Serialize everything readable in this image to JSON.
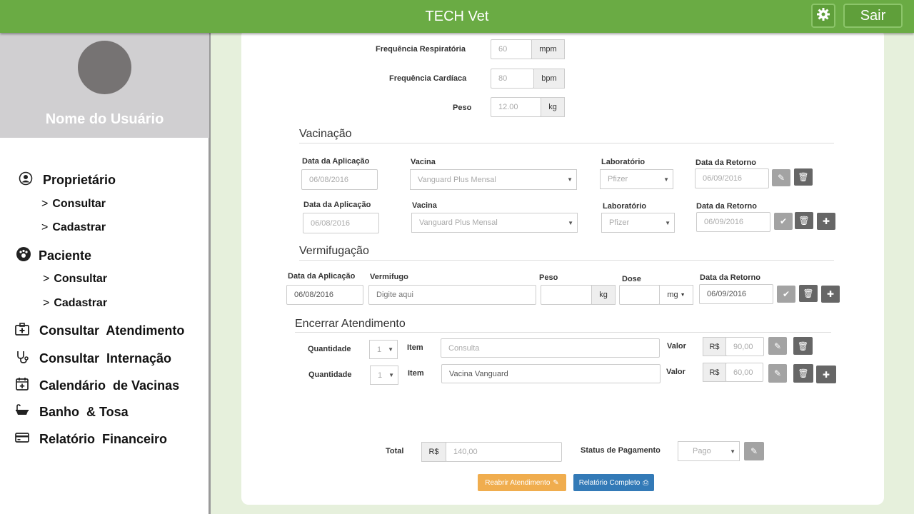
{
  "header": {
    "title": "TECH Vet",
    "logout": "Sair",
    "settings_icon": "gear-icon"
  },
  "sidebar": {
    "user_name": "Nome do Usuário",
    "items": [
      {
        "label": "Proprietário",
        "icon": "user-circle-icon",
        "subitems": [
          "Consultar",
          "Cadastrar"
        ]
      },
      {
        "label": "Paciente",
        "icon": "paw-icon",
        "subitems": [
          "Consultar",
          "Cadastrar"
        ]
      },
      {
        "label": "Consultar  Atendimento",
        "icon": "medical-kit-icon"
      },
      {
        "label": "Consultar  Internação",
        "icon": "stethoscope-icon"
      },
      {
        "label": "Calendário  de Vacinas",
        "icon": "calendar-plus-icon"
      },
      {
        "label": "Banho  & Tosa",
        "icon": "bathtub-icon"
      },
      {
        "label": "Relatório  Financeiro",
        "icon": "credit-card-icon"
      }
    ]
  },
  "vitals": [
    {
      "label": "Frequência Respiratória",
      "value": "60",
      "unit": "mpm"
    },
    {
      "label": "Frequência Cardíaca",
      "value": "80",
      "unit": "bpm"
    },
    {
      "label": "Peso",
      "value": "12.00",
      "unit": "kg"
    }
  ],
  "vacinacao": {
    "title": "Vacinação",
    "labels": {
      "date": "Data da Aplicação",
      "vaccine": "Vacina",
      "lab": "Laboratório",
      "return": "Data da Retorno"
    },
    "rows": [
      {
        "date": "06/08/2016",
        "vaccine": "Vanguard Plus Mensal",
        "lab": "Pfizer",
        "return": "06/09/2016"
      },
      {
        "date": "06/08/2016",
        "vaccine": "Vanguard Plus Mensal",
        "lab": "Pfizer",
        "return": "06/09/2016"
      }
    ]
  },
  "vermifugacao": {
    "title": "Vermifugação",
    "labels": {
      "date": "Data da Aplicação",
      "vermifugo": "Vermifugo",
      "peso": "Peso",
      "dose": "Dose",
      "return": "Data da Retorno"
    },
    "row": {
      "date": "06/08/2016",
      "vermifugo_placeholder": "Digite aqui",
      "peso_unit": "kg",
      "dose_unit": "mg",
      "return": "06/09/2016"
    }
  },
  "encerrar": {
    "title": "Encerrar Atendimento",
    "labels": {
      "qty": "Quantidade",
      "item": "Item",
      "value": "Valor",
      "currency": "R$"
    },
    "rows": [
      {
        "qty": "1",
        "item": "Consulta",
        "value": "90,00"
      },
      {
        "qty": "1",
        "item": "Vacina Vanguard",
        "value": "60,00"
      }
    ]
  },
  "totals": {
    "total_label": "Total",
    "currency": "R$",
    "total": "140,00",
    "status_label": "Status de Pagamento",
    "status": "Pago"
  },
  "actions": {
    "reopen": "Reabrir Atendimento",
    "report": "Relatório Completo"
  },
  "colors": {
    "header": "#6aab44",
    "reopen": "#f0ad4e",
    "report": "#337ab7"
  }
}
